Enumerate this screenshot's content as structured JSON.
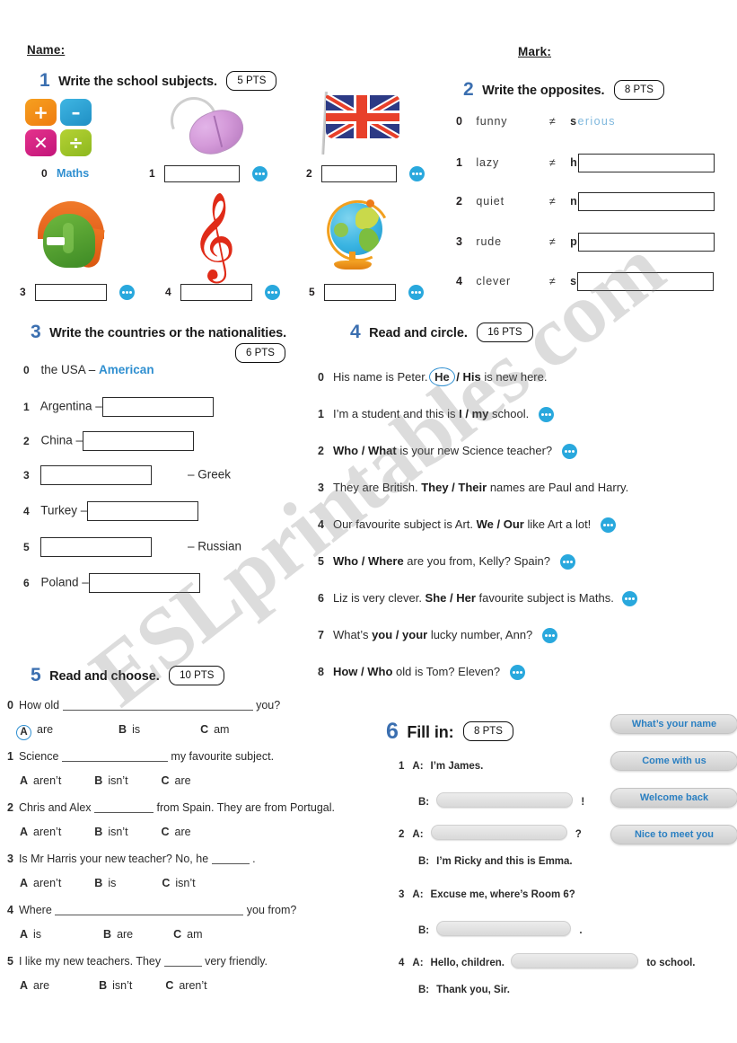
{
  "header": {
    "name_label": "Name:",
    "mark_label": "Mark:"
  },
  "watermark": "ESLprintables.com",
  "colors": {
    "exercise_number": "#3b6fb0",
    "sample_answer": "#2f8fd0",
    "audio_icon": "#29a8dd",
    "pill_text": "#2a7fc1",
    "circle_highlight": "#2f8fd0"
  },
  "exercise1": {
    "number": "1",
    "title": "Write the school subjects.",
    "points": "5 PTS",
    "items": [
      {
        "num": "0",
        "icon": "maths-icon",
        "answer": "Maths",
        "has_audio": false
      },
      {
        "num": "1",
        "icon": "computer-mouse-icon",
        "answer": "",
        "has_audio": true
      },
      {
        "num": "2",
        "icon": "union-jack-flag-icon",
        "answer": "",
        "has_audio": true
      },
      {
        "num": "3",
        "icon": "greek-helmet-icon",
        "answer": "",
        "has_audio": true
      },
      {
        "num": "4",
        "icon": "treble-clef-icon",
        "answer": "",
        "has_audio": true
      },
      {
        "num": "5",
        "icon": "globe-icon",
        "answer": "",
        "has_audio": true
      }
    ]
  },
  "exercise2": {
    "number": "2",
    "title": "Write the opposites.",
    "points": "8 PTS",
    "sign": "≠",
    "items": [
      {
        "num": "0",
        "word": "funny",
        "hint": "s",
        "answer": "erious",
        "solved": true
      },
      {
        "num": "1",
        "word": "lazy",
        "hint": "h",
        "answer": "",
        "solved": false
      },
      {
        "num": "2",
        "word": "quiet",
        "hint": "n",
        "answer": "",
        "solved": false
      },
      {
        "num": "3",
        "word": "rude",
        "hint": "p",
        "answer": "",
        "solved": false
      },
      {
        "num": "4",
        "word": "clever",
        "hint": "s",
        "answer": "",
        "solved": false
      }
    ]
  },
  "exercise3": {
    "number": "3",
    "title": "Write the countries or the nationalities.",
    "points": "6 PTS",
    "items": [
      {
        "num": "0",
        "left": "the USA",
        "dash": "–",
        "right": "American",
        "blank_side": "none"
      },
      {
        "num": "1",
        "left": "Argentina",
        "dash": "–",
        "right": "",
        "blank_side": "right"
      },
      {
        "num": "2",
        "left": "China",
        "dash": "–",
        "right": "",
        "blank_side": "right"
      },
      {
        "num": "3",
        "left": "",
        "dash": "–",
        "right": "Greek",
        "blank_side": "left"
      },
      {
        "num": "4",
        "left": "Turkey",
        "dash": "–",
        "right": "",
        "blank_side": "right"
      },
      {
        "num": "5",
        "left": "",
        "dash": "–",
        "right": "Russian",
        "blank_side": "left"
      },
      {
        "num": "6",
        "left": "Poland",
        "dash": "–",
        "right": "",
        "blank_side": "right"
      }
    ]
  },
  "exercise4": {
    "number": "4",
    "title": "Read and circle.",
    "points": "16 PTS",
    "items": [
      {
        "num": "0",
        "pre": "His name is Peter. ",
        "opt_a": "He",
        "sep": " / ",
        "opt_b": "His",
        "post": " is new here.",
        "circled": "a",
        "audio": false
      },
      {
        "num": "1",
        "pre": "I’m a student and this is ",
        "opt_a": "I",
        "sep": " / ",
        "opt_b": "my",
        "post": " school.",
        "circled": "",
        "audio": true
      },
      {
        "num": "2",
        "pre": "",
        "opt_a": "Who",
        "sep": " / ",
        "opt_b": "What",
        "post": " is your new Science teacher?",
        "circled": "",
        "audio": true
      },
      {
        "num": "3",
        "pre": "They are British. ",
        "opt_a": "They",
        "sep": " / ",
        "opt_b": "Their",
        "post": " names are Paul and Harry.",
        "circled": "",
        "audio": false
      },
      {
        "num": "4",
        "pre": "Our favourite subject is Art. ",
        "opt_a": "We",
        "sep": " / ",
        "opt_b": "Our",
        "post": " like Art a lot!",
        "circled": "",
        "audio": true
      },
      {
        "num": "5",
        "pre": "",
        "opt_a": "Who",
        "sep": " / ",
        "opt_b": "Where",
        "post": " are you from, Kelly? Spain?",
        "circled": "",
        "audio": true
      },
      {
        "num": "6",
        "pre": "Liz is very clever. ",
        "opt_a": "She",
        "sep": " / ",
        "opt_b": "Her",
        "post": " favourite subject is Maths.",
        "circled": "",
        "audio": true
      },
      {
        "num": "7",
        "pre": "What’s ",
        "opt_a": "you",
        "sep": " / ",
        "opt_b": "your",
        "post": " lucky number, Ann?",
        "circled": "",
        "audio": true
      },
      {
        "num": "8",
        "pre": "",
        "opt_a": "How",
        "sep": " / ",
        "opt_b": "Who",
        "post": " old is Tom? Eleven?",
        "circled": "",
        "audio": true
      }
    ]
  },
  "exercise5": {
    "number": "5",
    "title": "Read and choose.",
    "points": "10 PTS",
    "items": [
      {
        "num": "0",
        "pre": "How old",
        "post": "you?",
        "gap": 160,
        "options": [
          "are",
          "is",
          "am"
        ],
        "letters": [
          "A",
          "B",
          "C"
        ],
        "circled": "A"
      },
      {
        "num": "1",
        "pre": "Science",
        "post": "my favourite subject.",
        "gap": 112,
        "options": [
          "aren’t",
          "isn’t",
          "are"
        ],
        "letters": [
          "A",
          "B",
          "C"
        ],
        "circled": ""
      },
      {
        "num": "2",
        "pre": "Chris and Alex",
        "post": "from Spain. They are from Portugal.",
        "gap": 62,
        "options": [
          "aren’t",
          "isn’t",
          "are"
        ],
        "letters": [
          "A",
          "B",
          "C"
        ],
        "circled": ""
      },
      {
        "num": "3",
        "pre": "Is Mr Harris your new teacher? No, he",
        "post": ".",
        "gap": 40,
        "options": [
          "aren’t",
          "is",
          "isn’t"
        ],
        "letters": [
          "A",
          "B",
          "C"
        ],
        "circled": ""
      },
      {
        "num": "4",
        "pre": "Where",
        "post": "you from?",
        "gap": 158,
        "options": [
          "is",
          "are",
          "am"
        ],
        "letters": [
          "A",
          "B",
          "C"
        ],
        "circled": ""
      },
      {
        "num": "5",
        "pre": "I like my new teachers. They",
        "post": "very friendly.",
        "gap": 40,
        "options": [
          "are",
          "isn’t",
          "aren’t"
        ],
        "letters": [
          "A",
          "B",
          "C"
        ],
        "circled": ""
      }
    ]
  },
  "exercise6": {
    "number": "6",
    "title": "Fill in:",
    "points": "8 PTS",
    "word_bank": [
      "What’s your name",
      "Come with us",
      "Welcome back",
      "Nice to meet you"
    ],
    "dialogues": [
      {
        "num": "1",
        "lines": [
          {
            "speaker": "A:",
            "pre": "I’m James.",
            "gap": 0,
            "post": ""
          },
          {
            "speaker": "B:",
            "pre": "",
            "gap": 150,
            "post": "!"
          }
        ]
      },
      {
        "num": "2",
        "lines": [
          {
            "speaker": "A:",
            "pre": "",
            "gap": 150,
            "post": "?"
          },
          {
            "speaker": "B:",
            "pre": "I’m Ricky and this is Emma.",
            "gap": 0,
            "post": ""
          }
        ]
      },
      {
        "num": "3",
        "lines": [
          {
            "speaker": "A:",
            "pre": "Excuse me, where’s Room 6?",
            "gap": 0,
            "post": ""
          },
          {
            "speaker": "B:",
            "pre": "",
            "gap": 148,
            "post": "."
          }
        ]
      },
      {
        "num": "4",
        "lines": [
          {
            "speaker": "A:",
            "pre": "Hello, children.",
            "gap": 140,
            "post": "to school."
          },
          {
            "speaker": "B:",
            "pre": "Thank you, Sir.",
            "gap": 0,
            "post": ""
          }
        ]
      }
    ]
  }
}
